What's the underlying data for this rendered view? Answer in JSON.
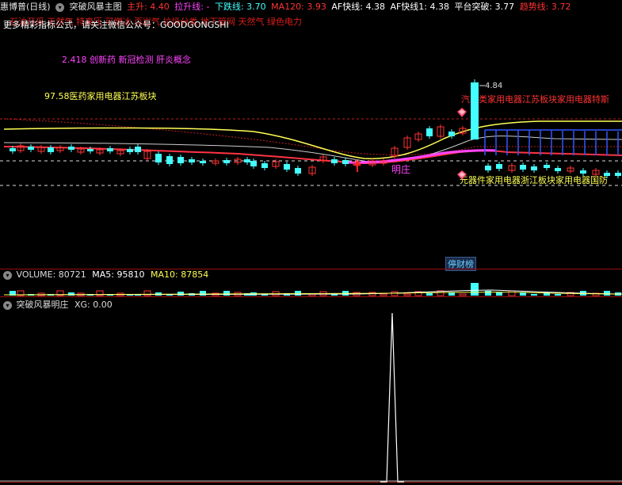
{
  "header": {
    "stock": "惠博普(日线)",
    "indicator": "突破风暴主图",
    "items": [
      {
        "label": "主升: 4.40",
        "color": "#ff3333"
      },
      {
        "label": "拉升线: -",
        "color": "#ff44ff"
      },
      {
        "label": "下跌线: 3.70",
        "color": "#44ffff"
      },
      {
        "label": "MA120: 3.93",
        "color": "#ff3333"
      },
      {
        "label": "AF快线: 4.38",
        "color": "#ffffff"
      },
      {
        "label": "AF快线1: 4.38",
        "color": "#ffffff"
      },
      {
        "label": "平台突破: 3.77",
        "color": "#ffffff"
      },
      {
        "label": "趋势线: 3.72",
        "color": "#ff3333"
      }
    ]
  },
  "marquee": "石油开采 天然气 特高压 可燃冰 页岩气 垃圾分类 地下管网 天然气 绿色电力",
  "notice": "更多精彩指标公式，请关注微信公众号：GOODGONGSHI",
  "annotations": {
    "concepts": "2.418  创新药 新冠检测 肝炎概念",
    "left": "97.58医药家用电器江苏板块",
    "right_top": "汽车类家用电器江苏板块家用电器特斯",
    "right_bottom": "元器件家用电器浙江板块家用电器国防",
    "price_high": "4.84",
    "zhuang": "明庄"
  },
  "tingcai": "停财榜",
  "volume": {
    "label": "VOLUME: 80721",
    "ma5": "MA5: 95810",
    "ma10": "MA10: 87854"
  },
  "indicator2": {
    "name": "突破风暴明庄",
    "xg": "XG: 0.00"
  },
  "colors": {
    "up": "#ff3333",
    "down": "#44ffff",
    "ma_yellow": "#ffff55",
    "ma_white": "#ffffff",
    "ma_pink": "#ff44ff",
    "separator": "#9a1010"
  }
}
